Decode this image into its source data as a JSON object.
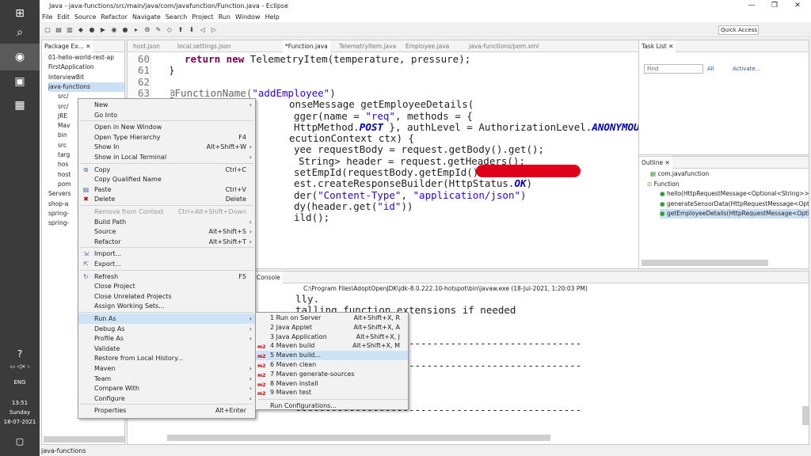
{
  "taskbar": {
    "lang": "ENG",
    "time": "13:51",
    "day": "Sunday",
    "date": "18-07-2021"
  },
  "title": "Java - java-functions/src/main/java/com/javafunction/Function.java - Eclipse",
  "menu": [
    "File",
    "Edit",
    "Source",
    "Refactor",
    "Navigate",
    "Search",
    "Project",
    "Run",
    "Window",
    "Help"
  ],
  "quick_access": "Quick Access",
  "explorer": {
    "tab": "Package Ex...",
    "items": [
      "01-hello-world-rest-ap",
      "FirstApplication",
      "InterviewBit",
      "java-functions",
      "src/",
      "src/",
      "JRE",
      "Mav",
      "bin",
      "src",
      "targ",
      "hos",
      "host",
      "pom",
      "Servers",
      "shop-a",
      "spring-",
      "spring-"
    ]
  },
  "editor": {
    "tabs": [
      "host.json",
      "local.settings.json",
      "*Function.java",
      "TelemetryItem.java",
      "Employee.java",
      "java-functions/pom.xml"
    ],
    "line_numbers": [
      "60",
      "61",
      "62",
      "63"
    ],
    "lines": [
      {
        "k": "return new",
        "t": " TelemetryItem(temperature, pressure);"
      },
      {
        "t": "}"
      },
      {
        "t": ""
      },
      {
        "a": "@FunctionName(",
        "s": "\"addEmployee\"",
        "t2": ")"
      },
      {
        "t": "onseMessage getEmployeeDetails("
      },
      {
        "t": "gger(name = ",
        "s": "\"req\"",
        "t2": ", methods = {"
      },
      {
        "t": "HttpMethod.",
        "c": "POST",
        "t2": " }, authLevel = AuthorizationLevel.",
        "c2": "ANONYMOUS",
        "t3": ") HttpRe"
      },
      {
        "t": "ecutionContext ctx) {"
      },
      {
        "t": "yee requestBody = request.getBody().get();"
      },
      {
        "t": "String> header = request.getHeaders();"
      },
      {
        "t": "setEmpId(requestBody.getEmpId() "
      },
      {
        "t": "est.createResponseBuilder(HttpStatus.",
        "c": "OK",
        "t2": ")"
      },
      {
        "t": "der(",
        "s": "\"Content-Type\"",
        "t2": ", ",
        "s2": "\"application/json\"",
        "t3": ")"
      },
      {
        "t": "dy(header.get(",
        "s": "\"id\"",
        "t2": "))"
      },
      {
        "t": "ild();"
      }
    ]
  },
  "tasklist": {
    "tab": "Task List",
    "find": "Find",
    "all": "All",
    "activate": "Activate..."
  },
  "outline": {
    "tab": "Outline",
    "items": [
      "com.javafunction",
      "Function",
      "hello(HttpRequestMessage<Optional<String>>,",
      "generateSensorData(HttpRequestMessage<Opti",
      "getEmployeeDetails(HttpRequestMessage<Opti"
    ]
  },
  "console": {
    "tab": "Console",
    "header": "C:\\Program Files\\AdoptOpenJDK\\jdk-8.0.222.10-hotspot\\bin\\javaw.exe (18-Jul-2021, 1:20:03 PM)",
    "lines": [
      "lly.",
      "talling function extensions if needed",
      "ension",
      "------------------------------------------------",
      "------------------------------------------------",
      "------------------------------------------------"
    ]
  },
  "context_menu": [
    {
      "label": "New",
      "arrow": true
    },
    {
      "label": "Go Into"
    },
    {
      "sep": true
    },
    {
      "label": "Open in New Window"
    },
    {
      "label": "Open Type Hierarchy",
      "sc": "F4"
    },
    {
      "label": "Show In",
      "sc": "Alt+Shift+W",
      "arrow": true
    },
    {
      "label": "Show in Local Terminal",
      "arrow": true
    },
    {
      "sep": true
    },
    {
      "label": "Copy",
      "sc": "Ctrl+C",
      "icon": "copy-icon"
    },
    {
      "label": "Copy Qualified Name"
    },
    {
      "label": "Paste",
      "sc": "Ctrl+V",
      "icon": "paste-icon"
    },
    {
      "label": "Delete",
      "sc": "Delete",
      "icon": "delete-icon"
    },
    {
      "sep": true
    },
    {
      "label": "Remove from Context",
      "sc": "Ctrl+Alt+Shift+Down",
      "dis": true
    },
    {
      "label": "Build Path",
      "arrow": true
    },
    {
      "label": "Source",
      "sc": "Alt+Shift+S",
      "arrow": true
    },
    {
      "label": "Refactor",
      "sc": "Alt+Shift+T",
      "arrow": true
    },
    {
      "sep": true
    },
    {
      "label": "Import...",
      "icon": "import-icon"
    },
    {
      "label": "Export...",
      "icon": "export-icon"
    },
    {
      "sep": true
    },
    {
      "label": "Refresh",
      "sc": "F5",
      "icon": "refresh-icon"
    },
    {
      "label": "Close Project"
    },
    {
      "label": "Close Unrelated Projects"
    },
    {
      "label": "Assign Working Sets..."
    },
    {
      "sep": true
    },
    {
      "label": "Run As",
      "arrow": true,
      "hl": true
    },
    {
      "label": "Debug As",
      "arrow": true
    },
    {
      "label": "Profile As",
      "arrow": true
    },
    {
      "label": "Validate"
    },
    {
      "label": "Restore from Local History..."
    },
    {
      "label": "Maven",
      "arrow": true
    },
    {
      "label": "Team",
      "arrow": true
    },
    {
      "label": "Compare With",
      "arrow": true
    },
    {
      "label": "Configure",
      "arrow": true
    },
    {
      "sep": true
    },
    {
      "label": "Properties",
      "sc": "Alt+Enter"
    }
  ],
  "submenu": [
    {
      "label": "1 Run on Server",
      "sc": "Alt+Shift+X, R"
    },
    {
      "label": "2 Java Applet",
      "sc": "Alt+Shift+X, A"
    },
    {
      "label": "3 Java Application",
      "sc": "Alt+Shift+X, J"
    },
    {
      "label": "4 Maven build",
      "sc": "Alt+Shift+X, M",
      "m2": true
    },
    {
      "label": "5 Maven build...",
      "m2": true,
      "hl": true
    },
    {
      "label": "6 Maven clean",
      "m2": true
    },
    {
      "label": "7 Maven generate-sources",
      "m2": true
    },
    {
      "label": "8 Maven install",
      "m2": true
    },
    {
      "label": "9 Maven test",
      "m2": true
    },
    {
      "sep": true
    },
    {
      "label": "Run Configurations..."
    }
  ],
  "status": "java-functions"
}
